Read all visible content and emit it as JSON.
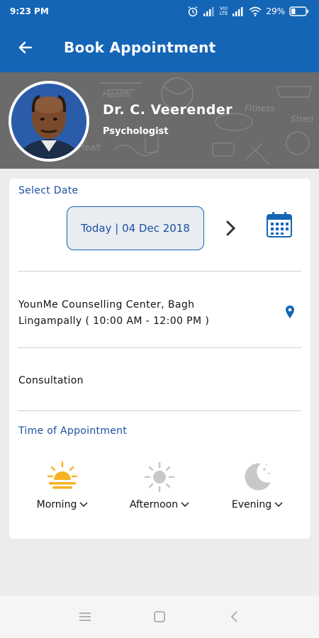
{
  "status_bar": {
    "time": "9:23 PM",
    "network_labels": [
      "Vo)",
      "LTE"
    ],
    "battery_percent": "29%",
    "battery_level": 0.29,
    "icons": [
      "alarm-icon",
      "signal-icon",
      "signal-icon",
      "wifi-icon",
      "battery-icon"
    ]
  },
  "app_bar": {
    "title": "Book Appointment",
    "back_icon": "arrow-left-icon"
  },
  "doctor": {
    "name": "Dr. C. Veerender",
    "specialty": "Psychologist"
  },
  "select_date": {
    "label": "Select Date",
    "date_text": "Today | 04 Dec 2018",
    "next_icon": "chevron-right-icon",
    "calendar_icon": "calendar-icon"
  },
  "location": {
    "text": "YounMe Counselling Center, Bagh Lingampally ( 10:00 AM - 12:00 PM )",
    "pin_icon": "location-pin-icon"
  },
  "consultation": {
    "text": "Consultation"
  },
  "time_of_appointment": {
    "label": "Time of Appointment",
    "slots": [
      {
        "label": "Morning",
        "icon": "sunrise-icon",
        "active": true
      },
      {
        "label": "Afternoon",
        "icon": "sun-icon",
        "active": false
      },
      {
        "label": "Evening",
        "icon": "moon-icon",
        "active": false
      }
    ]
  },
  "colors": {
    "primary": "#1565b6",
    "accent_label": "#1c4fa0",
    "morning_icon": "#f5b223",
    "inactive_icon": "#c8c8c8"
  },
  "nav_bar": {
    "icons": [
      "menu-icon",
      "home-icon",
      "back-icon"
    ]
  }
}
